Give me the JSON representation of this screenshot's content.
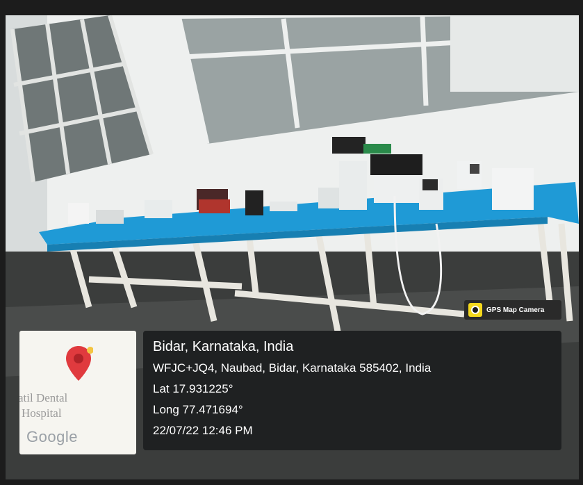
{
  "gps_badge": {
    "icon": "camera-pin-icon",
    "label": "GPS Map Camera"
  },
  "map_thumbnail": {
    "place_text_line1": "atil Dental",
    "place_text_line2": "l Hospital",
    "provider": "Google",
    "pin_color": "#e03a3e"
  },
  "location": {
    "city_line": "Bidar, Karnataka, India",
    "address": "WFJC+JQ4, Naubad, Bidar, Karnataka 585402, India",
    "latitude": "Lat 17.931225°",
    "longitude": "Long 77.471694°",
    "timestamp": "22/07/22 12:46 PM"
  },
  "colors": {
    "table_cover": "#1f9ad6",
    "stamp_background": "#1f2122",
    "badge_icon": "#f4d81c"
  }
}
